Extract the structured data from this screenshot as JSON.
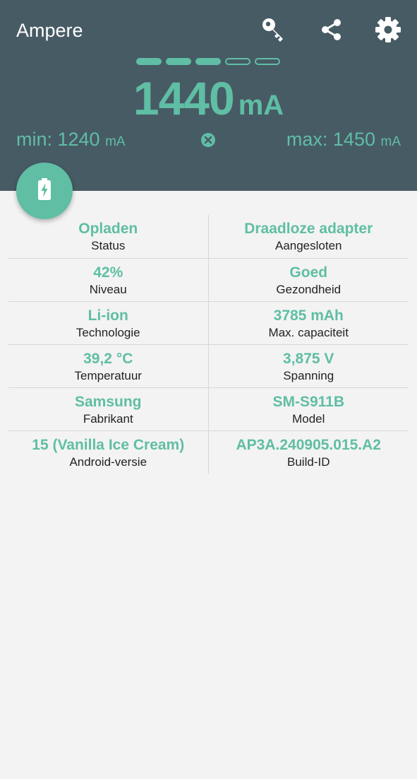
{
  "app": {
    "title": "Ampere"
  },
  "toolbar": {
    "actions": [
      {
        "icon": "key-icon"
      },
      {
        "icon": "share-icon"
      },
      {
        "icon": "gear-icon"
      }
    ]
  },
  "reading": {
    "level_segments_total": 5,
    "level_segments_filled": 3,
    "current_value": "1440",
    "current_unit": "mA",
    "min_label": "min: 1240",
    "min_unit": "mA",
    "max_label": "max: 1450",
    "max_unit": "mA"
  },
  "fab": {
    "icon": "battery-charging-icon"
  },
  "info_rows": [
    [
      {
        "value": "Opladen",
        "label": "Status"
      },
      {
        "value": "Draadloze adapter",
        "label": "Aangesloten"
      }
    ],
    [
      {
        "value": "42%",
        "label": "Niveau"
      },
      {
        "value": "Goed",
        "label": "Gezondheid"
      }
    ],
    [
      {
        "value": "Li-ion",
        "label": "Technologie"
      },
      {
        "value": "3785 mAh",
        "label": "Max. capaciteit"
      }
    ],
    [
      {
        "value": "39,2 °C",
        "label": "Temperatuur"
      },
      {
        "value": "3,875 V",
        "label": "Spanning"
      }
    ],
    [
      {
        "value": "Samsung",
        "label": "Fabrikant"
      },
      {
        "value": "SM-S911B",
        "label": "Model"
      }
    ],
    [
      {
        "value": "15 (Vanilla Ice Cream)",
        "label": "Android-versie"
      },
      {
        "value": "AP3A.240905.015.A2",
        "label": "Build-ID"
      }
    ]
  ],
  "colors": {
    "header_bg": "#475b65",
    "accent": "#5fbea4",
    "body_bg": "#f3f3f3",
    "label_text": "#222222"
  }
}
